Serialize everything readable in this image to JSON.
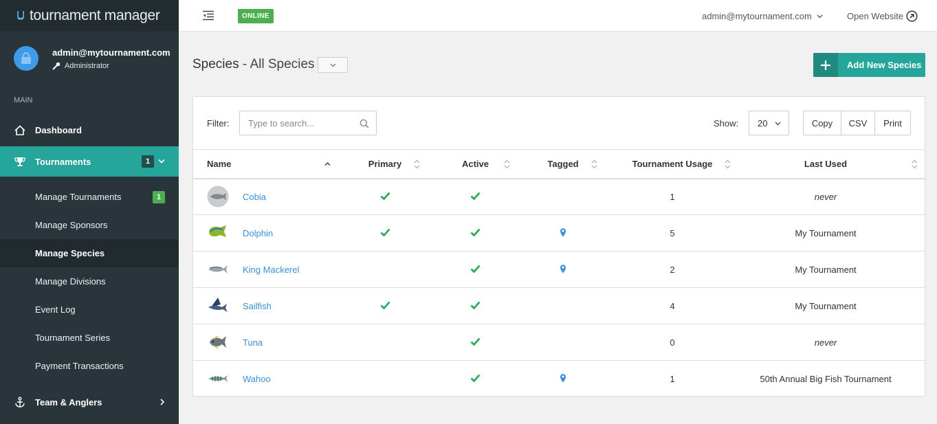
{
  "app": {
    "title": "tournament manager",
    "status": "ONLINE"
  },
  "colors": {
    "accent": "#26a69a",
    "sidebar": "#2a353b",
    "online": "#4caf50",
    "link": "#3a8fd6",
    "check": "#2eaa5c"
  },
  "user": {
    "email": "admin@mytournament.com",
    "role": "Administrator"
  },
  "topbar": {
    "account": "admin@mytournament.com",
    "open_website": "Open Website"
  },
  "sidebar": {
    "section": "MAIN",
    "dashboard": "Dashboard",
    "tournaments": {
      "label": "Tournaments",
      "badge": "1"
    },
    "sub": {
      "manage_tournaments": {
        "label": "Manage Tournaments",
        "badge": "1"
      },
      "manage_sponsors": "Manage Sponsors",
      "manage_species": "Manage Species",
      "manage_divisions": "Manage Divisions",
      "event_log": "Event Log",
      "tournament_series": "Tournament Series",
      "payment_transactions": "Payment Transactions"
    },
    "team_anglers": "Team & Anglers"
  },
  "page": {
    "title": "Species",
    "subtitle": "- All Species",
    "add_button": "Add New Species"
  },
  "toolbar": {
    "filter_label": "Filter:",
    "search_placeholder": "Type to search...",
    "show_label": "Show:",
    "show_value": "20",
    "copy": "Copy",
    "csv": "CSV",
    "print": "Print"
  },
  "table": {
    "headers": {
      "name": "Name",
      "primary": "Primary",
      "active": "Active",
      "tagged": "Tagged",
      "usage": "Tournament Usage",
      "last_used": "Last Used"
    },
    "rows": [
      {
        "name": "Cobia",
        "primary": true,
        "active": true,
        "tagged": false,
        "usage": "1",
        "last_used": "never",
        "icon": "cobia-fish-icon"
      },
      {
        "name": "Dolphin",
        "primary": true,
        "active": true,
        "tagged": true,
        "usage": "5",
        "last_used": "My Tournament",
        "icon": "dolphin-fish-icon"
      },
      {
        "name": "King Mackerel",
        "primary": false,
        "active": true,
        "tagged": true,
        "usage": "2",
        "last_used": "My Tournament",
        "icon": "king-mackerel-fish-icon"
      },
      {
        "name": "Sailfish",
        "primary": true,
        "active": true,
        "tagged": false,
        "usage": "4",
        "last_used": "My Tournament",
        "icon": "sailfish-fish-icon"
      },
      {
        "name": "Tuna",
        "primary": false,
        "active": true,
        "tagged": false,
        "usage": "0",
        "last_used": "never",
        "icon": "tuna-fish-icon"
      },
      {
        "name": "Wahoo",
        "primary": false,
        "active": true,
        "tagged": true,
        "usage": "1",
        "last_used": "50th Annual Big Fish Tournament",
        "icon": "wahoo-fish-icon"
      }
    ]
  }
}
